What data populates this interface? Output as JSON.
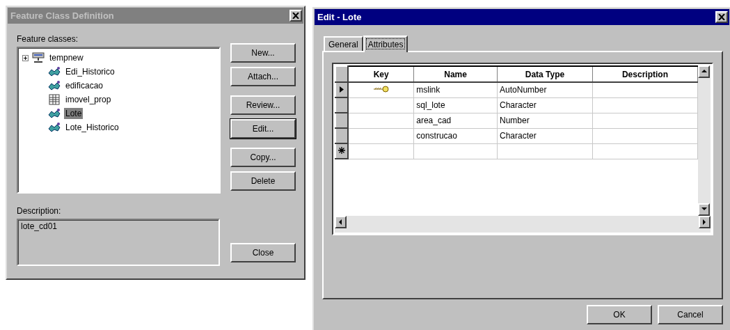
{
  "left_dialog": {
    "title": "Feature Class Definition",
    "active": false,
    "tree_label": "Feature classes:",
    "tree": [
      {
        "label": "tempnew",
        "kind": "database",
        "expanded": false,
        "selected": false,
        "children": [
          {
            "label": "Edi_Historico",
            "kind": "feature",
            "selected": false
          },
          {
            "label": "edificacao",
            "kind": "feature",
            "selected": false
          },
          {
            "label": "imovel_prop",
            "kind": "table",
            "selected": false
          },
          {
            "label": "Lote",
            "kind": "feature",
            "selected": true
          },
          {
            "label": "Lote_Historico",
            "kind": "feature",
            "selected": false
          }
        ]
      }
    ],
    "buttons": [
      {
        "label": "New...",
        "default": false
      },
      {
        "label": "Attach...",
        "default": false
      },
      {
        "label": "Review...",
        "default": false
      },
      {
        "label": "Edit...",
        "default": true
      },
      {
        "label": "Copy...",
        "default": false
      },
      {
        "label": "Delete",
        "default": false
      }
    ],
    "description_label": "Description:",
    "description": "lote_cd01",
    "close_button": "Close"
  },
  "right_dialog": {
    "title": "Edit - Lote",
    "active": true,
    "tabs": [
      {
        "label": "General",
        "selected": false
      },
      {
        "label": "Attributes",
        "selected": true
      }
    ],
    "table": {
      "columns": [
        "Key",
        "Name",
        "Data Type",
        "Description"
      ],
      "rows": [
        {
          "current": true,
          "new_row": false,
          "key": true,
          "name": "mslink",
          "data_type": "AutoNumber"
        },
        {
          "current": false,
          "new_row": false,
          "key": false,
          "name": "sql_lote",
          "data_type": "Character"
        },
        {
          "current": false,
          "new_row": false,
          "key": false,
          "name": "area_cad",
          "data_type": "Number"
        },
        {
          "current": false,
          "new_row": false,
          "key": false,
          "name": "construcao",
          "data_type": "Character"
        },
        {
          "current": false,
          "new_row": true,
          "key": false
        }
      ]
    },
    "buttons": [
      "OK",
      "Cancel"
    ]
  }
}
